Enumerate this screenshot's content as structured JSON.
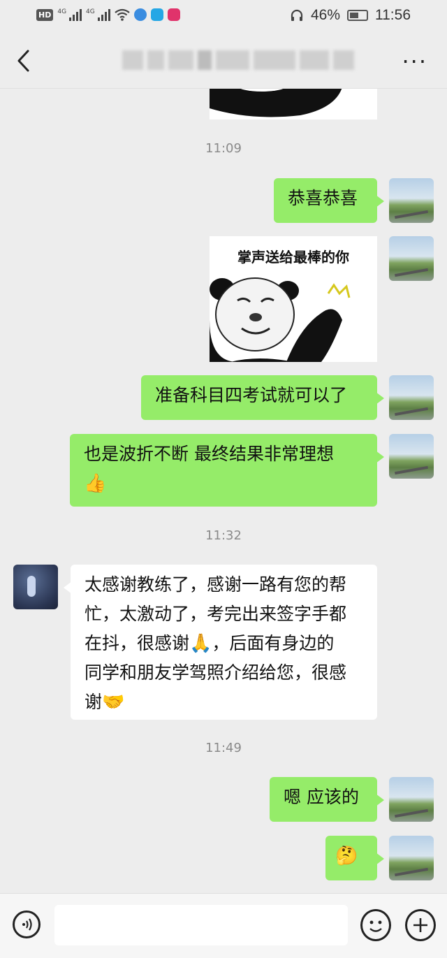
{
  "status_bar": {
    "hd_badge": "HD",
    "signal_1": "4G",
    "signal_2": "4G",
    "battery_percent": "46%",
    "time": "11:56"
  },
  "nav": {
    "back_icon": "chevron-left-icon",
    "more_icon": "ellipsis-icon",
    "more_label": "···"
  },
  "messages": {
    "time_1": "11:09",
    "msg_1": "恭喜恭喜",
    "sticker_caption": "掌声送给最棒的你",
    "msg_2": "准备科目四考试就可以了",
    "msg_3_line1": "也是波折不断 最终结果非常理想",
    "msg_3_emoji": "👍",
    "time_2": "11:32",
    "msg_4_line1": "太感谢教练了，感谢一路有您的帮",
    "msg_4_line2": "忙，太激动了，考完出来签字手都",
    "msg_4_line3a": "在抖，很感谢",
    "msg_4_emoji_1": "🙏",
    "msg_4_line3b": "，后面有身边的",
    "msg_4_line4": "同学和朋友学驾照介绍给您，很感",
    "msg_4_line5": "谢",
    "msg_4_emoji_2": "🤝",
    "time_3": "11:49",
    "msg_5": "嗯 应该的",
    "msg_6_emoji": "🤔"
  },
  "input_bar": {
    "voice_icon": "voice-icon",
    "emoji_icon": "emoji-icon",
    "plus_icon": "plus-icon"
  },
  "colors": {
    "background": "#ededed",
    "bubble_self": "#95ec69",
    "bubble_other": "#ffffff",
    "timestamp": "#8a8a8a"
  }
}
